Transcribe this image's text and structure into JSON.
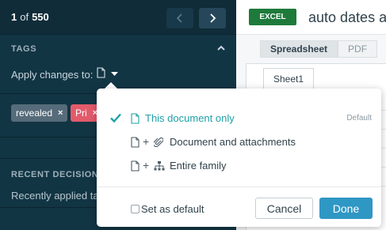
{
  "navigation": {
    "current": "1",
    "of_label": "of",
    "total": "550"
  },
  "tags_panel": {
    "header": "TAGS",
    "apply_label": "Apply changes to:",
    "chips": [
      {
        "label": "revealed",
        "remove": "×",
        "color": "#566c7a"
      },
      {
        "label": "Pri",
        "remove": "×",
        "color": "#e35b6b"
      }
    ]
  },
  "recent": {
    "header": "RECENT DECISIONS",
    "text": "Recently applied tags"
  },
  "document": {
    "type_badge": "EXCEL",
    "title": "auto dates and",
    "view_tabs": [
      "Spreadsheet",
      "PDF"
    ],
    "sheet_tab": "Sheet1"
  },
  "apply_popover": {
    "options": [
      {
        "label": "This document only",
        "selected": true,
        "badge": "Default"
      },
      {
        "plus": "+",
        "label": "Document and attachments"
      },
      {
        "plus": "+",
        "label": "Entire family"
      }
    ],
    "set_default_label": "Set as default",
    "cancel_label": "Cancel",
    "done_label": "Done"
  },
  "colors": {
    "sidebar_bg": "#123544",
    "accent_teal": "#1fa0a6",
    "done_blue": "#2f97c4",
    "excel_green": "#1d7a3a"
  }
}
